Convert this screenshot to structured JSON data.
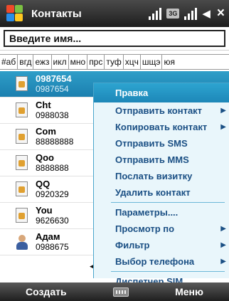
{
  "titlebar": {
    "title": "Контакты",
    "badge_3g": "3G",
    "close_label": "×"
  },
  "search": {
    "placeholder": "Введите имя..."
  },
  "alphabet": [
    "#аб",
    "вгд",
    "ежз",
    "икл",
    "мно",
    "прс",
    "туф",
    "хцч",
    "шщэ",
    "юя"
  ],
  "contacts": [
    {
      "name": "0987654",
      "number": "0987654",
      "icon": "contact-card-icon",
      "selected": true
    },
    {
      "name": "Cht",
      "number": "0988038",
      "icon": "contact-card-icon"
    },
    {
      "name": "Com",
      "number": "88888888",
      "icon": "contact-card-icon"
    },
    {
      "name": "Qoo",
      "number": "8888888",
      "icon": "contact-card-icon"
    },
    {
      "name": "QQ",
      "number": "0920329",
      "icon": "contact-card-icon"
    },
    {
      "name": "You",
      "number": "9626630",
      "icon": "contact-card-icon"
    },
    {
      "name": "Адам",
      "number": "0988675",
      "icon": "person-icon"
    }
  ],
  "menu": {
    "items": [
      {
        "label": "Правка",
        "highlighted": true
      },
      {
        "label": "Отправить контакт",
        "submenu": true
      },
      {
        "label": "Копировать контакт",
        "submenu": true
      },
      {
        "label": "Отправить SMS"
      },
      {
        "label": "Отправить MMS"
      },
      {
        "label": "Послать визитку"
      },
      {
        "label": "Удалить контакт"
      },
      {
        "label": "Параметры...."
      },
      {
        "label": "Просмотр по",
        "submenu": true
      },
      {
        "label": "Фильтр",
        "submenu": true
      },
      {
        "label": "Выбор телефона",
        "submenu": true
      },
      {
        "label": "Диспетчер SIM"
      }
    ]
  },
  "softkeys": {
    "left": "Создать",
    "right": "Меню"
  },
  "colors": {
    "selection": "#1b7faf",
    "menu_bg": "#e9f6fb",
    "menu_text": "#1a4f84"
  }
}
